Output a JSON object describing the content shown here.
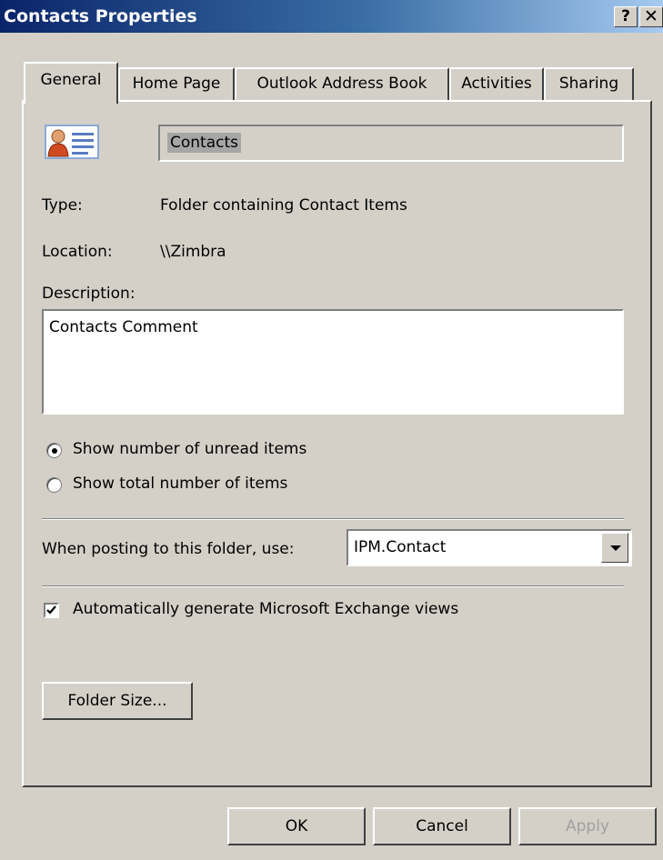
{
  "window": {
    "title": "Contacts Properties",
    "help_button": "?",
    "close_button": "✕"
  },
  "tabs": [
    {
      "label": "General",
      "active": true
    },
    {
      "label": "Home Page",
      "active": false
    },
    {
      "label": "Outlook Address Book",
      "active": false
    },
    {
      "label": "Activities",
      "active": false
    },
    {
      "label": "Sharing",
      "active": false
    }
  ],
  "general": {
    "folder_icon": "contact-card-icon",
    "name": "Contacts",
    "type_label": "Type:",
    "type_value": "Folder containing Contact Items",
    "location_label": "Location:",
    "location_value": "\\\\Zimbra",
    "description_label": "Description:",
    "description_value": "Contacts Comment",
    "radio_unread": "Show number of unread items",
    "radio_total": "Show total number of items",
    "selected_radio": "unread",
    "posting_label": "When posting to this folder, use:",
    "posting_value": "IPM.Contact",
    "auto_views_label": "Automatically generate Microsoft Exchange views",
    "auto_views_checked": true,
    "folder_size_button": "Folder Size..."
  },
  "footer": {
    "ok": "OK",
    "cancel": "Cancel",
    "apply": "Apply"
  },
  "colors": {
    "title_gradient_start": "#0a246a",
    "title_gradient_end": "#a6caf0",
    "dialog_face": "#d4d0c8"
  }
}
